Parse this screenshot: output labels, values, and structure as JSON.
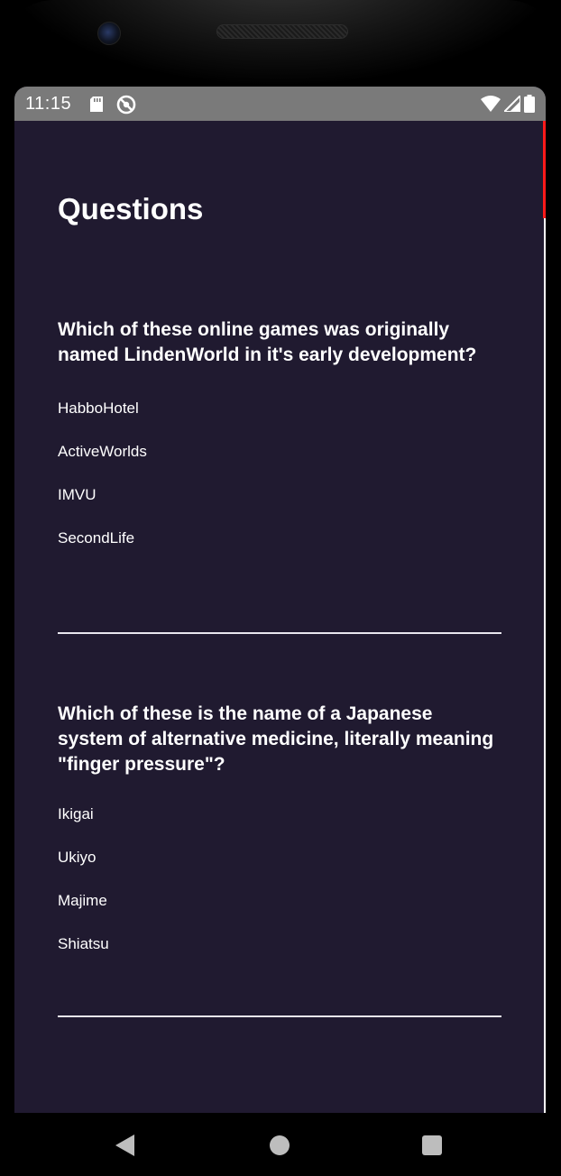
{
  "status_bar": {
    "time": "11:15",
    "icons": [
      "sd-card-icon",
      "do-not-disturb-icon",
      "wifi-icon",
      "signal-icon",
      "battery-icon"
    ]
  },
  "page": {
    "title": "Questions"
  },
  "questions": [
    {
      "text": "Which of these online games was originally named LindenWorld in it's early development?",
      "answers": [
        "HabboHotel",
        "ActiveWorlds",
        "IMVU",
        "SecondLife"
      ]
    },
    {
      "text": "Which of these is the name of a Japanese system of alternative medicine, literally meaning \"finger pressure\"?",
      "answers": [
        "Ikigai",
        "Ukiyo",
        "Majime",
        "Shiatsu"
      ]
    }
  ],
  "navigation_bar": {
    "icons": [
      "back-icon",
      "home-icon",
      "recents-icon"
    ]
  },
  "colors": {
    "background": "#201a30",
    "status_bar": "#7a7a7a",
    "text": "#ffffff",
    "scroll_indicator": "#ff1a1a"
  }
}
